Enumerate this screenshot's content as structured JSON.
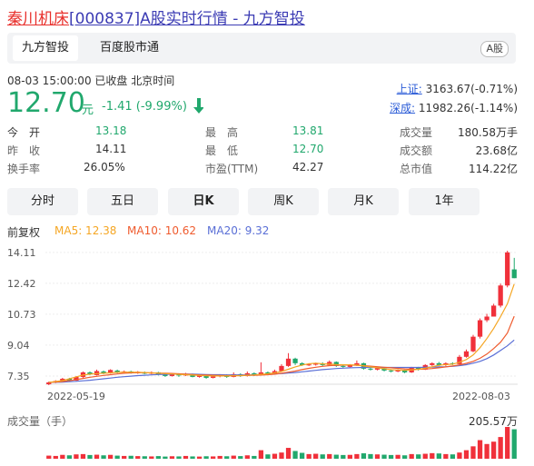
{
  "title": {
    "name": "秦川机床",
    "code": "[000837]",
    "rest": "A股实时行情 - 九方智投"
  },
  "tabs": [
    {
      "label": "九方智投"
    },
    {
      "label": "百度股市通"
    }
  ],
  "market_badge": "A股",
  "meta": "08-03 15:00:00   已收盘  北京时间",
  "price": {
    "value": "12.70",
    "unit": "元",
    "change": "-1.41 (-9.99%)",
    "color": "#21a86d"
  },
  "indices": [
    {
      "label": "上证:",
      "value": "3163.67(-0.71%)"
    },
    {
      "label": "深成:",
      "value": "11982.26(-1.14%)"
    }
  ],
  "stats": [
    {
      "label": "今　开",
      "value": "13.18"
    },
    {
      "label": "最　高",
      "value": "13.81"
    },
    {
      "label": "成交量",
      "value": "180.58万手"
    },
    {
      "label": "昨　收",
      "value": "14.11"
    },
    {
      "label": "最　低",
      "value": "12.70"
    },
    {
      "label": "成交额",
      "value": "23.68亿"
    },
    {
      "label": "换手率",
      "value": "26.05%"
    },
    {
      "label": "市盈(TTM)",
      "value": "42.27"
    },
    {
      "label": "总市值",
      "value": "114.22亿"
    }
  ],
  "periods": [
    "分时",
    "五日",
    "日K",
    "周K",
    "月K",
    "1年"
  ],
  "active_period": "日K",
  "adjust": "前复权",
  "ma": [
    {
      "label": "MA5: 12.38",
      "color": "#f5a623"
    },
    {
      "label": "MA10: 10.62",
      "color": "#ef5b2e"
    },
    {
      "label": "MA20: 9.32",
      "color": "#5a6fd6"
    }
  ],
  "volume_label": "成交量（手）",
  "volume_max": "205.57万",
  "colors": {
    "up": "#f0303a",
    "down": "#21a86d",
    "ma5": "#f5a623",
    "ma10": "#ef5b2e",
    "ma20": "#5a6fd6"
  },
  "chart_data": {
    "type": "candlestick",
    "x_start": "2022-05-19",
    "x_end": "2022-08-03",
    "y_ticks": [
      "14.11",
      "12.42",
      "10.73",
      "9.04",
      "7.35"
    ],
    "ylim": [
      6.9,
      14.4
    ],
    "series": [
      {
        "o": 6.9,
        "c": 7.0,
        "h": 7.05,
        "l": 6.85
      },
      {
        "o": 7.0,
        "c": 7.08,
        "h": 7.12,
        "l": 6.96
      },
      {
        "o": 7.05,
        "c": 7.2,
        "h": 7.25,
        "l": 7.0
      },
      {
        "o": 7.2,
        "c": 7.1,
        "h": 7.25,
        "l": 7.05
      },
      {
        "o": 7.1,
        "c": 7.3,
        "h": 7.35,
        "l": 7.08
      },
      {
        "o": 7.3,
        "c": 7.55,
        "h": 7.6,
        "l": 7.25
      },
      {
        "o": 7.55,
        "c": 7.45,
        "h": 7.6,
        "l": 7.4
      },
      {
        "o": 7.4,
        "c": 7.62,
        "h": 7.7,
        "l": 7.38
      },
      {
        "o": 7.6,
        "c": 7.5,
        "h": 7.65,
        "l": 7.45
      },
      {
        "o": 7.5,
        "c": 7.68,
        "h": 7.72,
        "l": 7.48
      },
      {
        "o": 7.65,
        "c": 7.55,
        "h": 7.7,
        "l": 7.5
      },
      {
        "o": 7.55,
        "c": 7.6,
        "h": 7.65,
        "l": 7.52
      },
      {
        "o": 7.6,
        "c": 7.52,
        "h": 7.64,
        "l": 7.48
      },
      {
        "o": 7.5,
        "c": 7.58,
        "h": 7.62,
        "l": 7.47
      },
      {
        "o": 7.55,
        "c": 7.48,
        "h": 7.6,
        "l": 7.45
      },
      {
        "o": 7.48,
        "c": 7.55,
        "h": 7.6,
        "l": 7.45
      },
      {
        "o": 7.55,
        "c": 7.42,
        "h": 7.58,
        "l": 7.38
      },
      {
        "o": 7.42,
        "c": 7.35,
        "h": 7.48,
        "l": 7.3
      },
      {
        "o": 7.35,
        "c": 7.45,
        "h": 7.5,
        "l": 7.32
      },
      {
        "o": 7.45,
        "c": 7.38,
        "h": 7.5,
        "l": 7.3
      },
      {
        "o": 7.38,
        "c": 7.45,
        "h": 7.52,
        "l": 7.35
      },
      {
        "o": 7.45,
        "c": 7.3,
        "h": 7.48,
        "l": 7.28
      },
      {
        "o": 7.3,
        "c": 7.4,
        "h": 7.45,
        "l": 7.26
      },
      {
        "o": 7.4,
        "c": 7.25,
        "h": 7.42,
        "l": 7.2
      },
      {
        "o": 7.25,
        "c": 7.32,
        "h": 7.4,
        "l": 7.22
      },
      {
        "o": 7.32,
        "c": 7.4,
        "h": 7.45,
        "l": 7.28
      },
      {
        "o": 7.4,
        "c": 7.3,
        "h": 7.45,
        "l": 7.25
      },
      {
        "o": 7.3,
        "c": 7.45,
        "h": 7.55,
        "l": 7.28
      },
      {
        "o": 7.45,
        "c": 7.35,
        "h": 7.5,
        "l": 7.3
      },
      {
        "o": 7.35,
        "c": 7.5,
        "h": 7.6,
        "l": 7.32
      },
      {
        "o": 7.5,
        "c": 7.4,
        "h": 7.55,
        "l": 7.35
      },
      {
        "o": 7.4,
        "c": 7.55,
        "h": 8.1,
        "l": 7.38
      },
      {
        "o": 7.55,
        "c": 7.45,
        "h": 7.6,
        "l": 7.4
      },
      {
        "o": 7.45,
        "c": 7.62,
        "h": 7.7,
        "l": 7.42
      },
      {
        "o": 7.62,
        "c": 7.9,
        "h": 8.0,
        "l": 7.6
      },
      {
        "o": 7.9,
        "c": 8.3,
        "h": 8.6,
        "l": 7.85
      },
      {
        "o": 8.3,
        "c": 8.05,
        "h": 8.35,
        "l": 7.95
      },
      {
        "o": 8.05,
        "c": 7.95,
        "h": 8.1,
        "l": 7.9
      },
      {
        "o": 7.95,
        "c": 7.98,
        "h": 8.05,
        "l": 7.9
      },
      {
        "o": 7.98,
        "c": 8.02,
        "h": 8.08,
        "l": 7.92
      },
      {
        "o": 8.02,
        "c": 7.95,
        "h": 8.1,
        "l": 7.9
      },
      {
        "o": 7.95,
        "c": 8.12,
        "h": 8.2,
        "l": 7.92
      },
      {
        "o": 8.12,
        "c": 7.9,
        "h": 8.15,
        "l": 7.85
      },
      {
        "o": 7.9,
        "c": 7.85,
        "h": 7.95,
        "l": 7.8
      },
      {
        "o": 7.85,
        "c": 7.95,
        "h": 8.0,
        "l": 7.8
      },
      {
        "o": 7.95,
        "c": 8.05,
        "h": 8.2,
        "l": 7.9
      },
      {
        "o": 8.05,
        "c": 7.75,
        "h": 8.08,
        "l": 7.7
      },
      {
        "o": 7.75,
        "c": 7.7,
        "h": 7.82,
        "l": 7.65
      },
      {
        "o": 7.7,
        "c": 7.78,
        "h": 7.85,
        "l": 7.66
      },
      {
        "o": 7.78,
        "c": 7.65,
        "h": 7.82,
        "l": 7.6
      },
      {
        "o": 7.65,
        "c": 7.6,
        "h": 7.7,
        "l": 7.55
      },
      {
        "o": 7.6,
        "c": 7.68,
        "h": 7.72,
        "l": 7.56
      },
      {
        "o": 7.68,
        "c": 7.55,
        "h": 7.7,
        "l": 7.5
      },
      {
        "o": 7.55,
        "c": 7.8,
        "h": 7.85,
        "l": 7.52
      },
      {
        "o": 7.8,
        "c": 7.7,
        "h": 7.85,
        "l": 7.65
      },
      {
        "o": 7.7,
        "c": 7.95,
        "h": 8.0,
        "l": 7.68
      },
      {
        "o": 7.95,
        "c": 8.05,
        "h": 8.1,
        "l": 7.9
      },
      {
        "o": 8.05,
        "c": 7.95,
        "h": 8.12,
        "l": 7.9
      },
      {
        "o": 7.95,
        "c": 8.05,
        "h": 8.1,
        "l": 7.9
      },
      {
        "o": 8.05,
        "c": 8.0,
        "h": 8.1,
        "l": 7.95
      },
      {
        "o": 8.0,
        "c": 8.4,
        "h": 8.5,
        "l": 7.98
      },
      {
        "o": 8.4,
        "c": 8.7,
        "h": 8.8,
        "l": 8.35
      },
      {
        "o": 8.7,
        "c": 9.5,
        "h": 9.6,
        "l": 8.65
      },
      {
        "o": 9.5,
        "c": 10.4,
        "h": 10.5,
        "l": 9.4
      },
      {
        "o": 10.4,
        "c": 10.6,
        "h": 10.75,
        "l": 10.3
      },
      {
        "o": 10.6,
        "c": 11.2,
        "h": 11.3,
        "l": 11.1
      },
      {
        "o": 11.2,
        "c": 12.3,
        "h": 12.4,
        "l": 11.1
      },
      {
        "o": 12.3,
        "c": 14.11,
        "h": 14.2,
        "l": 12.2
      },
      {
        "o": 13.18,
        "c": 12.7,
        "h": 13.81,
        "l": 12.7
      }
    ],
    "ma5": [
      7.0,
      7.05,
      7.1,
      7.2,
      7.3,
      7.4,
      7.45,
      7.48,
      7.5,
      7.52,
      7.55,
      7.56,
      7.56,
      7.55,
      7.54,
      7.52,
      7.5,
      7.48,
      7.46,
      7.44,
      7.42,
      7.4,
      7.38,
      7.36,
      7.35,
      7.35,
      7.35,
      7.36,
      7.37,
      7.39,
      7.41,
      7.44,
      7.47,
      7.52,
      7.6,
      7.72,
      7.85,
      7.95,
      8.02,
      8.05,
      8.02,
      8.0,
      7.98,
      7.97,
      7.96,
      7.95,
      7.9,
      7.85,
      7.8,
      7.75,
      7.7,
      7.68,
      7.66,
      7.68,
      7.72,
      7.78,
      7.86,
      7.94,
      7.98,
      8.0,
      8.1,
      8.25,
      8.5,
      8.9,
      9.4,
      9.95,
      10.6,
      11.3,
      12.38
    ],
    "ma10": [
      7.0,
      7.02,
      7.05,
      7.1,
      7.15,
      7.22,
      7.28,
      7.33,
      7.38,
      7.42,
      7.46,
      7.5,
      7.52,
      7.53,
      7.53,
      7.52,
      7.51,
      7.5,
      7.49,
      7.47,
      7.45,
      7.43,
      7.41,
      7.4,
      7.39,
      7.38,
      7.37,
      7.37,
      7.37,
      7.38,
      7.39,
      7.4,
      7.42,
      7.45,
      7.5,
      7.56,
      7.62,
      7.7,
      7.77,
      7.83,
      7.88,
      7.92,
      7.94,
      7.95,
      7.95,
      7.94,
      7.92,
      7.89,
      7.86,
      7.83,
      7.8,
      7.77,
      7.74,
      7.72,
      7.72,
      7.73,
      7.76,
      7.8,
      7.85,
      7.9,
      7.96,
      8.04,
      8.15,
      8.32,
      8.55,
      8.85,
      9.2,
      9.7,
      10.62
    ],
    "ma20": [
      7.0,
      7.01,
      7.02,
      7.04,
      7.06,
      7.09,
      7.12,
      7.16,
      7.2,
      7.24,
      7.28,
      7.31,
      7.34,
      7.37,
      7.39,
      7.41,
      7.43,
      7.44,
      7.45,
      7.45,
      7.45,
      7.45,
      7.44,
      7.43,
      7.42,
      7.42,
      7.41,
      7.41,
      7.41,
      7.41,
      7.42,
      7.43,
      7.44,
      7.46,
      7.48,
      7.51,
      7.54,
      7.58,
      7.62,
      7.66,
      7.7,
      7.73,
      7.76,
      7.78,
      7.8,
      7.81,
      7.82,
      7.82,
      7.82,
      7.82,
      7.82,
      7.82,
      7.82,
      7.82,
      7.82,
      7.83,
      7.84,
      7.85,
      7.86,
      7.88,
      7.92,
      7.97,
      8.05,
      8.15,
      8.3,
      8.5,
      8.75,
      9.0,
      9.32
    ],
    "volume": [
      20,
      18,
      25,
      22,
      28,
      30,
      24,
      26,
      22,
      25,
      20,
      18,
      19,
      17,
      16,
      15,
      17,
      14,
      16,
      15,
      18,
      15,
      14,
      16,
      15,
      18,
      16,
      20,
      17,
      22,
      18,
      55,
      28,
      32,
      40,
      70,
      50,
      38,
      30,
      32,
      28,
      30,
      26,
      24,
      25,
      30,
      35,
      30,
      28,
      26,
      24,
      25,
      22,
      30,
      28,
      32,
      36,
      34,
      30,
      28,
      40,
      55,
      80,
      120,
      95,
      110,
      140,
      205,
      190
    ]
  }
}
